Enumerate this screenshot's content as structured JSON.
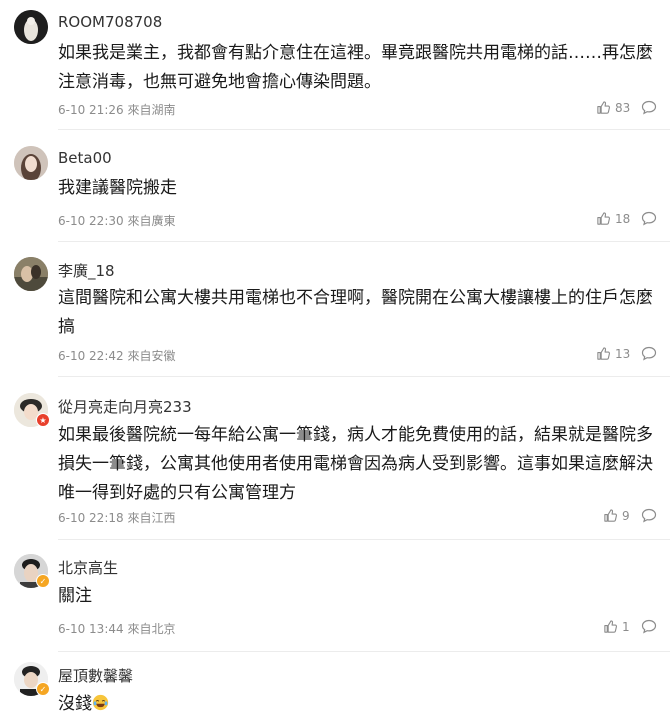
{
  "comments": [
    {
      "username": "ROOM708708",
      "text": "如果我是業主，我都會有點介意住在這裡。畢竟跟醫院共用電梯的話……再怎麼注意消毒，也無可避免地會擔心傳染問題。",
      "time": "6-10 21:26",
      "location": "來自湖南",
      "likes": "83"
    },
    {
      "username": "Beta00",
      "text": "我建議醫院搬走",
      "time": "6-10 22:30",
      "location": "來自廣東",
      "likes": "18"
    },
    {
      "username": "李廣_18",
      "text": "這間醫院和公寓大樓共用電梯也不合理啊，醫院開在公寓大樓讓樓上的住戶怎麼搞",
      "time": "6-10 22:42",
      "location": "來自安徽",
      "likes": "13"
    },
    {
      "username": "從月亮走向月亮233",
      "text": "如果最後醫院統一每年給公寓一筆錢，病人才能免費使用的話，結果就是醫院多損失一筆錢，公寓其他使用者使用電梯會因為病人受到影響。這事如果這麼解決唯一得到好處的只有公寓管理方",
      "time": "6-10 22:18",
      "location": "來自江西",
      "likes": "9"
    },
    {
      "username": "北京高生",
      "text": "關注",
      "time": "6-10 13:44",
      "location": "來自北京",
      "likes": "1"
    },
    {
      "username": "屋頂數馨馨",
      "text": "沒錢",
      "emoji": "laughing-tears",
      "time": "",
      "location": "",
      "likes": ""
    }
  ],
  "colors": {
    "text": "#1a1a1a",
    "meta": "#8c8c8c",
    "divider": "#ececec",
    "badge_red": "#e8402c",
    "badge_gold": "#f5a623"
  },
  "icons": {
    "like": "thumbs-up-icon",
    "reply": "comment-bubble-icon"
  }
}
